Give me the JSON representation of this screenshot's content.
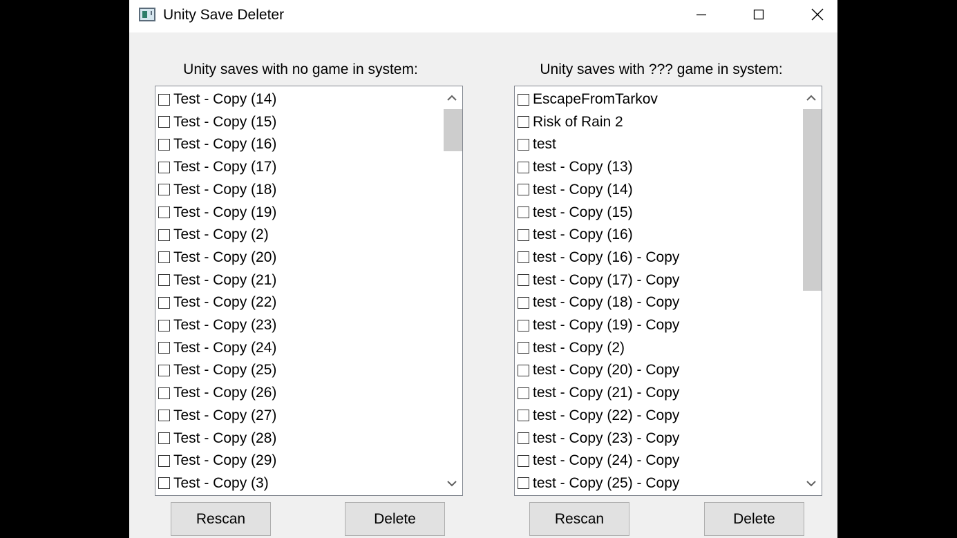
{
  "window": {
    "title": "Unity Save Deleter",
    "icon": "app-window-icon",
    "controls": [
      "minimize-icon",
      "maximize-icon",
      "close-icon"
    ]
  },
  "left_panel": {
    "label": "Unity saves with no game in system:",
    "items": [
      "Test - Copy (14)",
      "Test - Copy (15)",
      "Test - Copy (16)",
      "Test - Copy (17)",
      "Test - Copy (18)",
      "Test - Copy (19)",
      "Test - Copy (2)",
      "Test - Copy (20)",
      "Test - Copy (21)",
      "Test - Copy (22)",
      "Test - Copy (23)",
      "Test - Copy (24)",
      "Test - Copy (25)",
      "Test - Copy (26)",
      "Test - Copy (27)",
      "Test - Copy (28)",
      "Test - Copy (29)",
      "Test - Copy (3)"
    ],
    "checked": [
      false,
      false,
      false,
      false,
      false,
      false,
      false,
      false,
      false,
      false,
      false,
      false,
      false,
      false,
      false,
      false,
      false,
      false
    ],
    "rescan_label": "Rescan",
    "delete_label": "Delete"
  },
  "right_panel": {
    "label": "Unity saves with ??? game in system:",
    "items": [
      "EscapeFromTarkov",
      "Risk of Rain 2",
      "test",
      "test - Copy (13)",
      "test - Copy (14)",
      "test - Copy (15)",
      "test - Copy (16)",
      "test - Copy (16) - Copy",
      "test - Copy (17) - Copy",
      "test - Copy (18) - Copy",
      "test - Copy (19) - Copy",
      "test - Copy (2)",
      "test - Copy (20) - Copy",
      "test - Copy (21) - Copy",
      "test - Copy (22) - Copy",
      "test - Copy (23) - Copy",
      "test - Copy (24) - Copy",
      "test - Copy (25) - Copy"
    ],
    "checked": [
      false,
      false,
      false,
      false,
      false,
      false,
      false,
      false,
      false,
      false,
      false,
      false,
      false,
      false,
      false,
      false,
      false,
      false
    ],
    "rescan_label": "Rescan",
    "delete_label": "Delete"
  },
  "colors": {
    "window_bg": "#f0f0f0",
    "titlebar_bg": "#ffffff",
    "list_bg": "#ffffff",
    "list_border": "#828790",
    "scroll_thumb": "#cdcdcd",
    "button_bg": "#e1e1e1",
    "button_border": "#adadad"
  }
}
